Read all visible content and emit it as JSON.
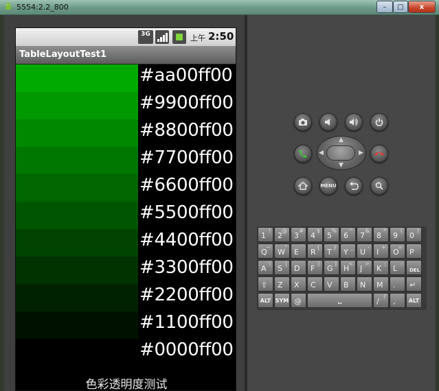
{
  "window": {
    "title": "5554:2.2_800",
    "controls": {
      "minimize": "–",
      "maximize": "□",
      "close": "x"
    }
  },
  "status_bar": {
    "network": "3G",
    "ampm": "上午",
    "time": "2:50"
  },
  "app": {
    "title": "TableLayoutTest1",
    "rows": [
      {
        "label": "#aa00ff00",
        "alpha": 0.667
      },
      {
        "label": "#9900ff00",
        "alpha": 0.6
      },
      {
        "label": "#8800ff00",
        "alpha": 0.533
      },
      {
        "label": "#7700ff00",
        "alpha": 0.467
      },
      {
        "label": "#6600ff00",
        "alpha": 0.4
      },
      {
        "label": "#5500ff00",
        "alpha": 0.333
      },
      {
        "label": "#4400ff00",
        "alpha": 0.267
      },
      {
        "label": "#3300ff00",
        "alpha": 0.2
      },
      {
        "label": "#2200ff00",
        "alpha": 0.133
      },
      {
        "label": "#1100ff00",
        "alpha": 0.067
      },
      {
        "label": "#0000ff00",
        "alpha": 0.0
      }
    ],
    "caption": "色彩透明度测试"
  },
  "controls": {
    "menu_label": "MENU",
    "buttons": [
      "camera-icon",
      "volume-down-icon",
      "volume-up-icon",
      "power-icon",
      "call-icon",
      "end-call-icon",
      "home-icon",
      "menu-button",
      "back-icon",
      "search-icon"
    ]
  },
  "keyboard": {
    "rows": [
      [
        [
          "1",
          "!"
        ],
        [
          "2",
          "@"
        ],
        [
          "3",
          "#"
        ],
        [
          "4",
          "$"
        ],
        [
          "5",
          "%"
        ],
        [
          "6",
          "^"
        ],
        [
          "7",
          "&"
        ],
        [
          "8",
          "*"
        ],
        [
          "9",
          "("
        ],
        [
          "0",
          ")"
        ]
      ],
      [
        [
          "Q",
          "~"
        ],
        [
          "W",
          "\""
        ],
        [
          "E",
          "`"
        ],
        [
          "R",
          "{"
        ],
        [
          "T",
          "}"
        ],
        [
          "Y",
          "_"
        ],
        [
          "U",
          "-"
        ],
        [
          "I",
          "+"
        ],
        [
          "O",
          "="
        ],
        [
          "P",
          ""
        ]
      ],
      [
        [
          "A",
          "\\"
        ],
        [
          "S",
          "|"
        ],
        [
          "D",
          ""
        ],
        [
          "F",
          "["
        ],
        [
          "G",
          "]"
        ],
        [
          "H",
          "<"
        ],
        [
          "J",
          ">"
        ],
        [
          "K",
          ";"
        ],
        [
          "L",
          ":"
        ],
        [
          "DEL",
          ""
        ]
      ],
      [
        [
          "⇧",
          ""
        ],
        [
          "Z",
          ""
        ],
        [
          "X",
          ""
        ],
        [
          "C",
          ""
        ],
        [
          "V",
          ""
        ],
        [
          "B",
          ""
        ],
        [
          "N",
          ""
        ],
        [
          "M",
          ""
        ],
        [
          ".",
          ""
        ],
        [
          "↵",
          ""
        ]
      ]
    ],
    "bottom": {
      "alt": "ALT",
      "sym": "SYM",
      "at": "@",
      "space": "␣",
      "slash": "/",
      "question": "?",
      "comma": ",",
      "alt_right": "ALT"
    }
  },
  "colors": {
    "swatch_base": "#00ff00",
    "screen_bg": "#000000",
    "label_text": "#ffffff"
  }
}
